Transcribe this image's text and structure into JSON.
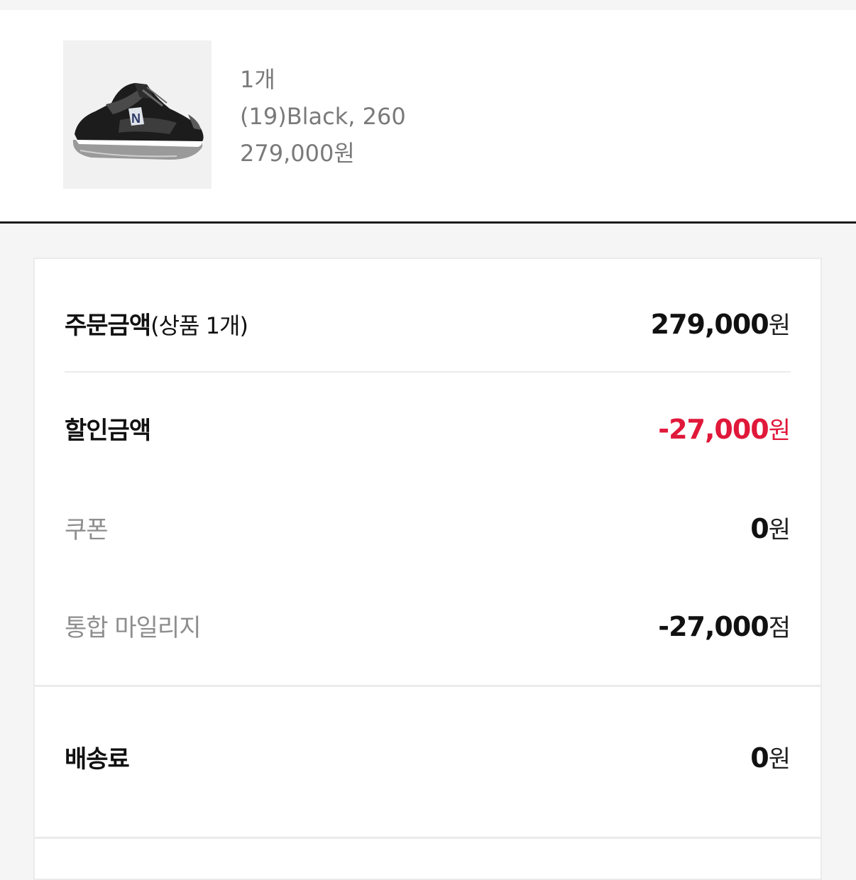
{
  "product": {
    "image_alt": "sneaker",
    "quantity": "1개",
    "option": "(19)Black, 260",
    "price": "279,000원"
  },
  "price_summary": {
    "order_amount": {
      "label": "주문금액",
      "sub_label": "(상품 1개)",
      "value": "279,000",
      "unit": "원"
    },
    "discount_amount": {
      "label": "할인금액",
      "value": "-27,000",
      "unit": "원"
    },
    "coupon": {
      "label": "쿠폰",
      "value": "0",
      "unit": "원"
    },
    "mileage": {
      "label": "통합 마일리지",
      "value": "-27,000",
      "unit": "점"
    }
  },
  "shipping": {
    "label": "배송료",
    "value": "0",
    "unit": "원"
  },
  "colors": {
    "discount_red": "#e0183a",
    "text_dark": "#111111",
    "text_muted": "#8e8e8e"
  }
}
